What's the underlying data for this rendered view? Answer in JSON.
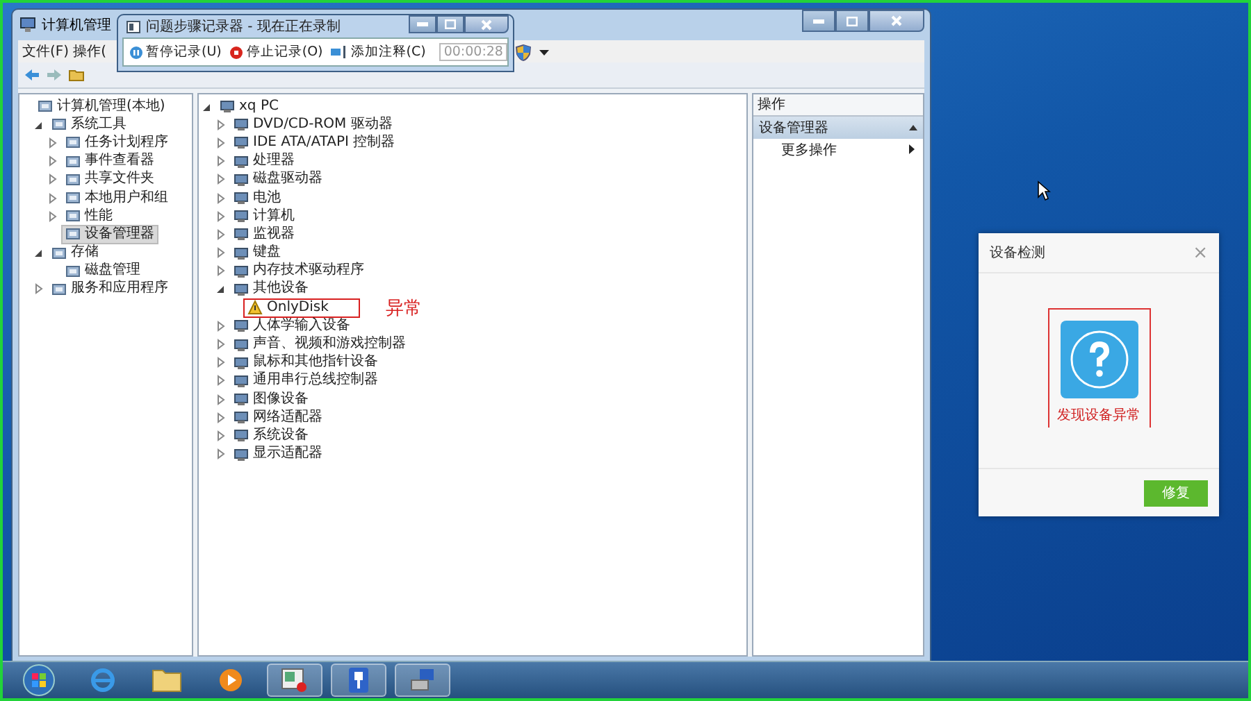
{
  "window": {
    "title": "计算机管理",
    "menu": [
      "文件(F)",
      "操作("
    ]
  },
  "recorder": {
    "title": "问题步骤记录器 - 现在正在录制",
    "buttons": [
      {
        "kind": "pause",
        "label": "暂停记录(U)"
      },
      {
        "kind": "stop",
        "label": "停止记录(O)"
      },
      {
        "kind": "comment",
        "label": "添加注释(C)"
      }
    ],
    "timer": "00:00:28"
  },
  "nav_tree": [
    {
      "label": "计算机管理(本地)",
      "selected": false,
      "children": [
        {
          "label": "系统工具",
          "expanded": true,
          "selected": false,
          "children": [
            {
              "label": "任务计划程序",
              "expanded": false,
              "selected": false
            },
            {
              "label": "事件查看器",
              "expanded": false,
              "selected": false
            },
            {
              "label": "共享文件夹",
              "expanded": false,
              "selected": false
            },
            {
              "label": "本地用户和组",
              "expanded": false,
              "selected": false
            },
            {
              "label": "性能",
              "expanded": false,
              "selected": false
            },
            {
              "label": "设备管理器",
              "selected": true
            }
          ]
        },
        {
          "label": "存储",
          "expanded": true,
          "selected": false,
          "children": [
            {
              "label": "磁盘管理",
              "selected": false
            }
          ]
        },
        {
          "label": "服务和应用程序",
          "expanded": false,
          "selected": false
        }
      ]
    }
  ],
  "device_tree": [
    {
      "label": "xq PC",
      "expanded": true,
      "children": [
        {
          "label": "DVD/CD-ROM 驱动器",
          "expanded": false
        },
        {
          "label": "IDE ATA/ATAPI 控制器",
          "expanded": false
        },
        {
          "label": "处理器",
          "expanded": false
        },
        {
          "label": "磁盘驱动器",
          "expanded": false
        },
        {
          "label": "电池",
          "expanded": false
        },
        {
          "label": "计算机",
          "expanded": false
        },
        {
          "label": "监视器",
          "expanded": false
        },
        {
          "label": "键盘",
          "expanded": false
        },
        {
          "label": "内存技术驱动程序",
          "expanded": false
        },
        {
          "label": "其他设备",
          "expanded": true,
          "children": [
            {
              "label": "OnlyDisk",
              "kind": "warning",
              "flagged": true,
              "note": "异常"
            }
          ]
        },
        {
          "label": "人体学输入设备",
          "expanded": false
        },
        {
          "label": "声音、视频和游戏控制器",
          "expanded": false
        },
        {
          "label": "鼠标和其他指针设备",
          "expanded": false
        },
        {
          "label": "通用串行总线控制器",
          "expanded": false
        },
        {
          "label": "图像设备",
          "expanded": false
        },
        {
          "label": "网络适配器",
          "expanded": false
        },
        {
          "label": "系统设备",
          "expanded": false
        },
        {
          "label": "显示适配器",
          "expanded": false
        }
      ]
    }
  ],
  "actions": {
    "header": "操作",
    "section": "设备管理器",
    "items": [
      "更多操作"
    ]
  },
  "dialog": {
    "title": "设备检测",
    "close": "×",
    "message": "发现设备异常",
    "button": "修复"
  },
  "taskbar": [
    {
      "kind": "start",
      "active": false
    },
    {
      "kind": "browser",
      "active": false
    },
    {
      "kind": "folder",
      "active": false
    },
    {
      "kind": "player",
      "active": false
    },
    {
      "kind": "recorder",
      "active": true
    },
    {
      "kind": "usb",
      "active": true
    },
    {
      "kind": "network",
      "active": true
    }
  ]
}
